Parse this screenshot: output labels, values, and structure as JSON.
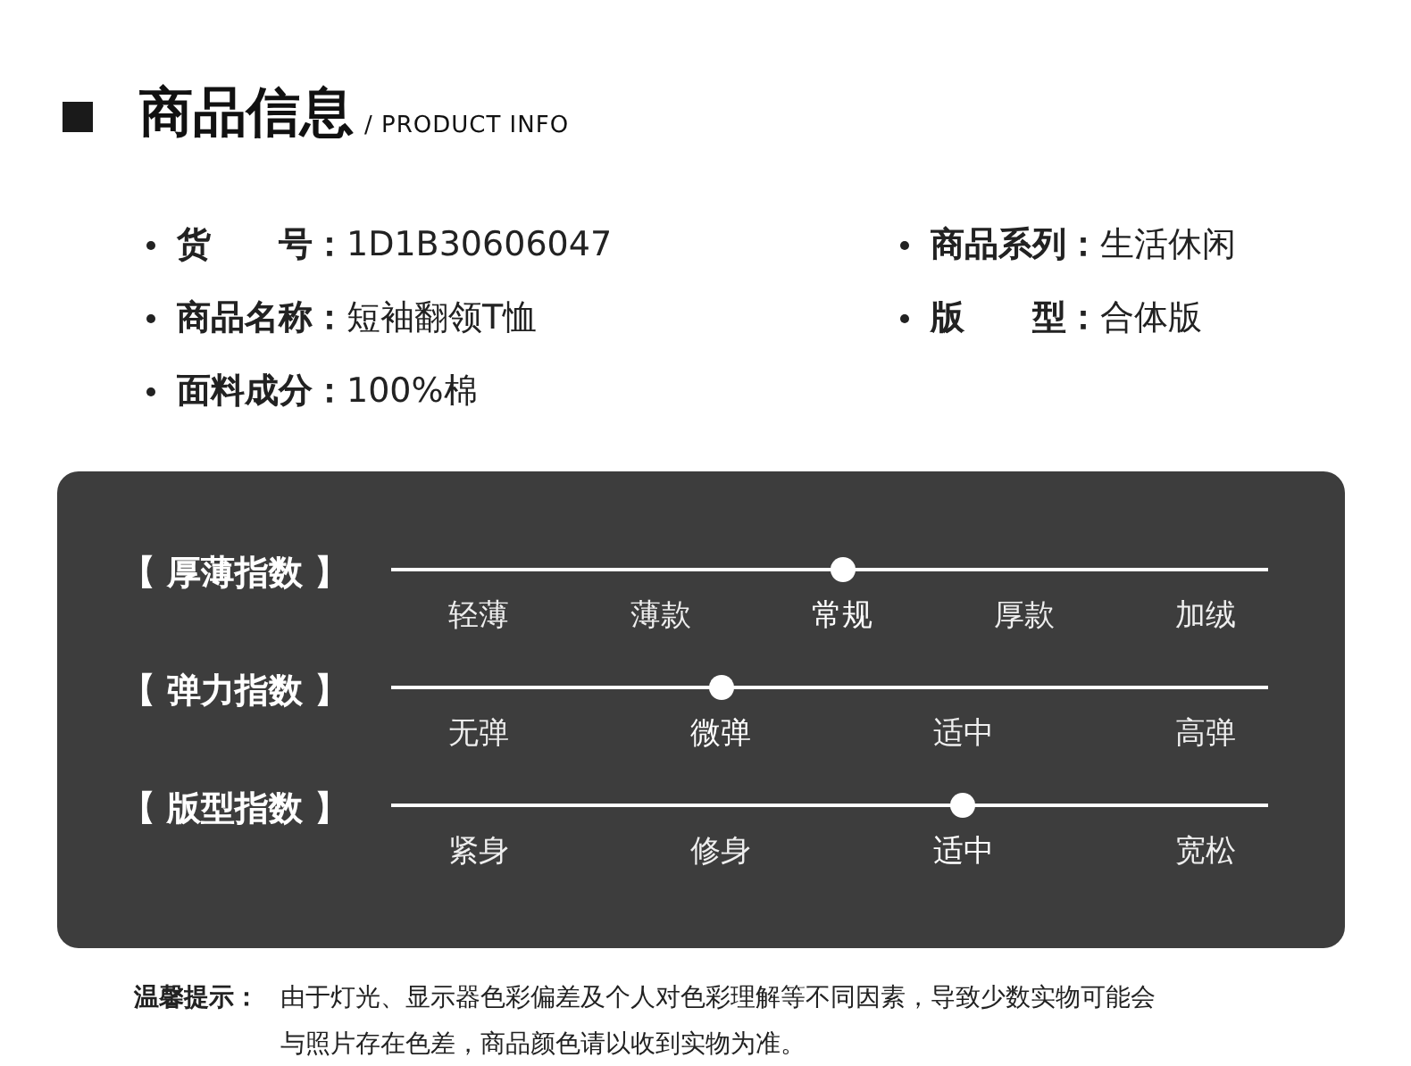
{
  "header": {
    "title": "商品信息",
    "subtitle": "/ PRODUCT INFO"
  },
  "specs": {
    "left_column": [
      {
        "label": "货　　号：",
        "value": "1D1B30606047"
      },
      {
        "label": "商品名称：",
        "value": "短袖翻领T恤"
      },
      {
        "label": "面料成分：",
        "value": "100%棉"
      }
    ],
    "right_column": [
      {
        "label": "商品系列：",
        "value": "生活休闲"
      },
      {
        "label": "版　　型：",
        "value": "合体版"
      }
    ]
  },
  "indices": [
    {
      "label": "【 厚薄指数 】",
      "options": [
        {
          "label": "轻薄",
          "selected": false
        },
        {
          "label": "薄款",
          "selected": false
        },
        {
          "label": "常规",
          "selected": true
        },
        {
          "label": "厚款",
          "selected": false
        },
        {
          "label": "加绒",
          "selected": false
        }
      ]
    },
    {
      "label": "【 弹力指数 】",
      "options": [
        {
          "label": "无弹",
          "selected": false
        },
        {
          "label": "微弹",
          "selected": true
        },
        {
          "label": "适中",
          "selected": false
        },
        {
          "label": "高弹",
          "selected": false
        }
      ]
    },
    {
      "label": "【 版型指数 】",
      "options": [
        {
          "label": "紧身",
          "selected": false
        },
        {
          "label": "修身",
          "selected": false
        },
        {
          "label": "适中",
          "selected": true
        },
        {
          "label": "宽松",
          "selected": false
        }
      ]
    }
  ],
  "note": {
    "label": "温馨提示：",
    "lines": [
      "由于灯光、显示器色彩偏差及个人对色彩理解等不同因素，导致少数实物可能会",
      "与照片存在色差，商品颜色请以收到实物为准。"
    ]
  }
}
